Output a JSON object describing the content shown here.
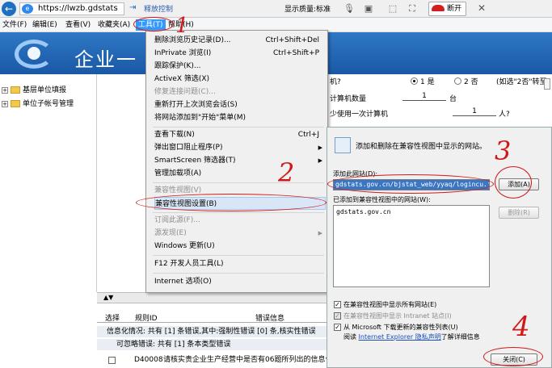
{
  "address_bar": {
    "url": "https://lwzb.gdstats",
    "remote_control": "释放控制",
    "quality_label": "显示质量:标准",
    "hangup_label": "断开"
  },
  "menubar": {
    "items": [
      "文件(F)",
      "编辑(E)",
      "查看(V)",
      "收藏夹(A)",
      "工具(T)",
      "帮助(H)"
    ]
  },
  "banner": {
    "title": "企业一"
  },
  "sidebar": {
    "items": [
      "基层单位填报",
      "单位子帐号管理"
    ]
  },
  "questions": {
    "q1_tail": "机?",
    "q1_yes": "1 是",
    "q1_no": "2 否",
    "q1_note": "(如选\"2否\"转至",
    "q2_label": "计算机数量",
    "q2_value": "1",
    "q2_unit": "台",
    "q3_label": "少使用一次计算机",
    "q3_value": "1",
    "q3_unit": "人?"
  },
  "tools_menu": {
    "items": [
      {
        "label": "删除浏览历史记录(D)...",
        "shortcut": "Ctrl+Shift+Del"
      },
      {
        "label": "InPrivate 浏览(I)",
        "shortcut": "Ctrl+Shift+P"
      },
      {
        "label": "跟踪保护(K)..."
      },
      {
        "label": "ActiveX 筛选(X)"
      },
      {
        "label": "修复连接问题(C)..."
      },
      {
        "label": "重新打开上次浏览会话(S)"
      },
      {
        "label": "将网站添加到\"开始\"菜单(M)"
      },
      {
        "label": "查看下载(N)",
        "shortcut": "Ctrl+J"
      },
      {
        "label": "弹出窗口阻止程序(P)"
      },
      {
        "label": "SmartScreen 筛选器(T)"
      },
      {
        "label": "管理加载项(A)"
      },
      {
        "label": "兼容性视图(V)"
      },
      {
        "label": "兼容性视图设置(B)"
      },
      {
        "label": "订阅此源(F)..."
      },
      {
        "label": "源发现(E)"
      },
      {
        "label": "Windows 更新(U)"
      },
      {
        "label": "F12 开发人员工具(L)"
      },
      {
        "label": "Internet 选项(O)"
      }
    ]
  },
  "compat_dialog": {
    "title": "添加和删除在兼容性视图中显示的网站。",
    "add_site_label": "添加此网站(D):",
    "add_site_value": "gdstats.gov.cn/bjstat_web/yyaq/logincu.jsp",
    "add_button": "添加(A)",
    "added_label": "已添加到兼容性视图中的网站(W):",
    "sites": [
      "gdstats.gov.cn"
    ],
    "remove_button": "删除(R)",
    "cb1": "在兼容性视图中显示所有网站(E)",
    "cb2": "在兼容性视图中显示 Intranet 站点(I)",
    "cb3": "从 Microsoft 下载更新的兼容性列表(U)",
    "read_prefix": "阅读",
    "privacy_link": "Internet Explorer 隐私声明",
    "read_suffix": "了解详细信息",
    "close_button": "关闭(C)"
  },
  "bottom_grid": {
    "headers": [
      "选择",
      "规则ID",
      "错误信息"
    ],
    "summary": "信息化情况: 共有 [1] 条错误,其中:强制性错误 [0] 条,核实性错误",
    "sub_summary": "可忽略错误: 共有 [1] 条本类型错误",
    "row_id": "D40008",
    "row_text": "请核实贵企业生产经营中是否有06题所列出的信息化"
  },
  "annotations": [
    "1",
    "2",
    "3",
    "4"
  ]
}
